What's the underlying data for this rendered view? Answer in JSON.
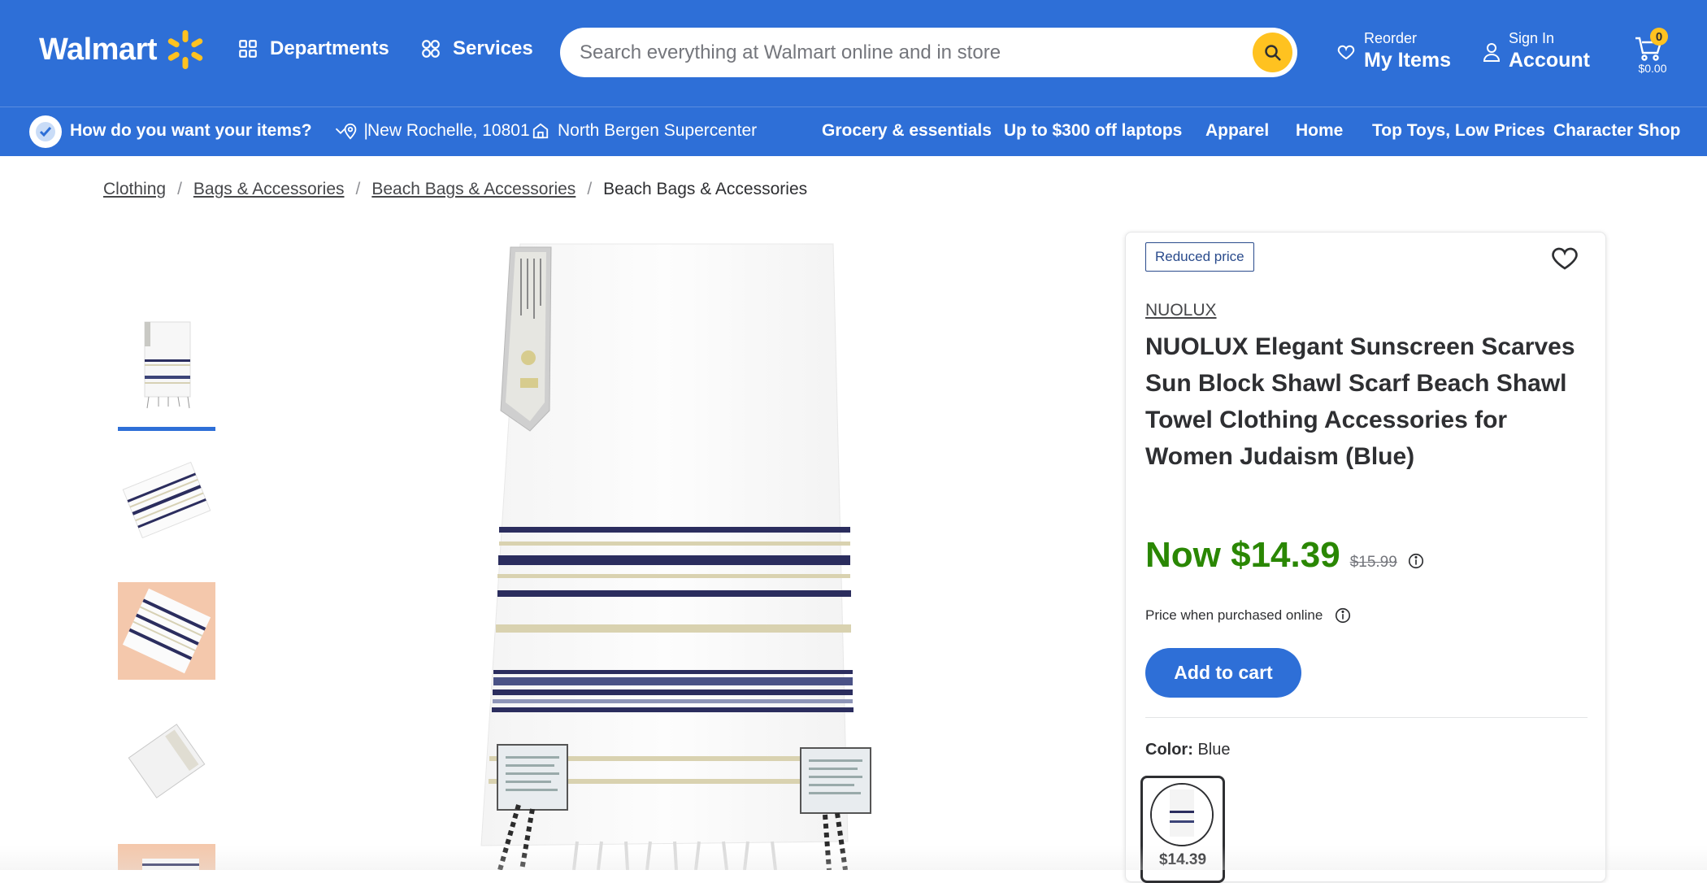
{
  "colors": {
    "brand_blue": "#2e6fd7",
    "spark_yellow": "#ffc220",
    "price_green": "#2a8703",
    "badge_navy": "#2a4b8c"
  },
  "header": {
    "logo_text": "Walmart",
    "departments_label": "Departments",
    "services_label": "Services",
    "search_placeholder": "Search everything at Walmart online and in store",
    "reorder_small": "Reorder",
    "reorder_big": "My Items",
    "signin_small": "Sign In",
    "signin_big": "Account",
    "cart_count": "0",
    "cart_total": "$0.00"
  },
  "subnav": {
    "fulfillment_prompt": "How do you want your items?",
    "divider": "|",
    "location": "New Rochelle, 10801",
    "store": "North Bergen Supercenter",
    "links": [
      "Grocery & essentials",
      "Up to $300 off laptops",
      "Apparel",
      "Home",
      "Top Toys, Low Prices",
      "Character Shop"
    ]
  },
  "breadcrumb": {
    "items": [
      "Clothing",
      "Bags & Accessories",
      "Beach Bags & Accessories"
    ],
    "current": "Beach Bags & Accessories",
    "separator": "/"
  },
  "product": {
    "badge": "Reduced price",
    "brand": "NUOLUX",
    "title": "NUOLUX Elegant Sunscreen Scarves Sun Block Shawl Scarf Beach Shawl Towel Clothing Accessories for Women Judaism (Blue)",
    "price_now": "Now $14.39",
    "price_was": "$15.99",
    "price_note": "Price when purchased online",
    "add_to_cart": "Add to cart",
    "color_label": "Color:",
    "color_value": "Blue",
    "swatch_price": "$14.39"
  },
  "icons": [
    "departments-grid-icon",
    "services-icon",
    "search-icon",
    "heart-icon",
    "user-icon",
    "cart-icon",
    "location-pin-icon",
    "store-icon",
    "chevron-down-icon",
    "info-icon",
    "wishlist-heart-icon"
  ]
}
